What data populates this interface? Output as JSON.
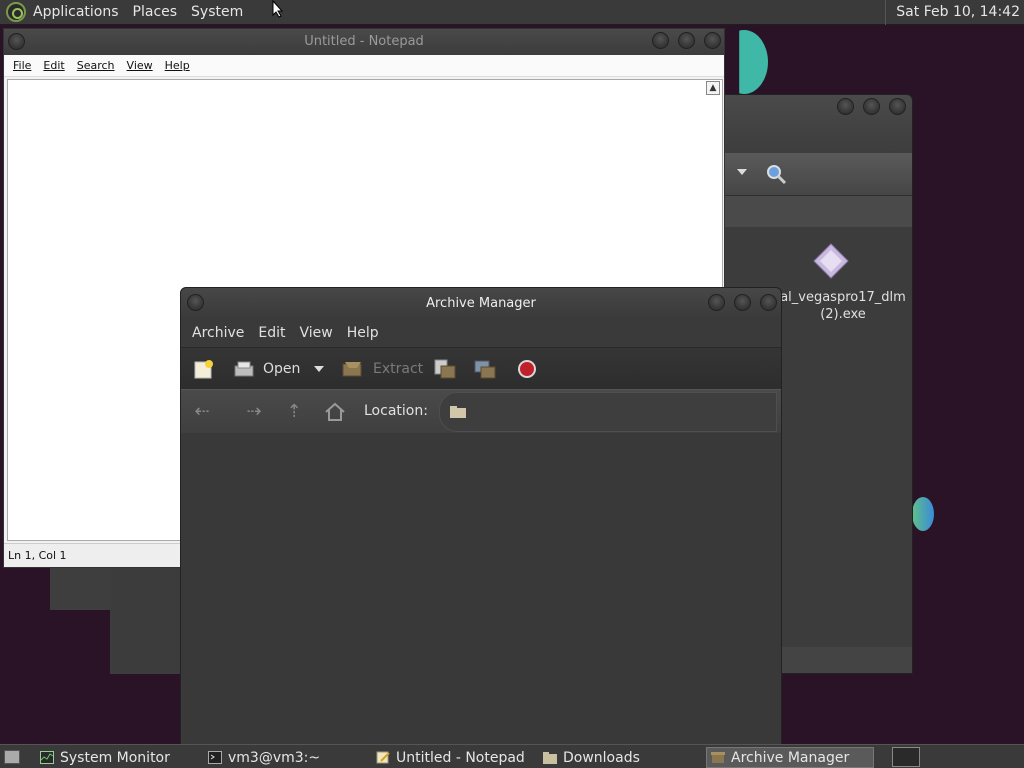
{
  "top_panel": {
    "menus": [
      "Applications",
      "Places",
      "System"
    ],
    "clock": "Sat Feb 10, 14:42"
  },
  "file_manager": {
    "file_label_line1": "al_vegaspro17_dlm",
    "file_label_line2": "(2).exe"
  },
  "notepad": {
    "title": "Untitled - Notepad",
    "menu": [
      "File",
      "Edit",
      "Search",
      "View",
      "Help"
    ],
    "status": "Ln 1, Col 1"
  },
  "archive_manager": {
    "title": "Archive Manager",
    "menu": [
      "Archive",
      "Edit",
      "View",
      "Help"
    ],
    "toolbar": {
      "open_label": "Open",
      "extract_label": "Extract"
    },
    "location_label": "Location:"
  },
  "taskbar": {
    "items": [
      {
        "label": "System Monitor",
        "icon": "system-monitor-icon"
      },
      {
        "label": "vm3@vm3:~",
        "icon": "terminal-icon"
      },
      {
        "label": "Untitled - Notepad",
        "icon": "notepad-icon"
      },
      {
        "label": "Downloads",
        "icon": "folder-icon"
      },
      {
        "label": "Archive Manager",
        "icon": "archive-manager-icon"
      }
    ],
    "active_index": 4
  },
  "colors": {
    "panel": "#3a3a3a",
    "desktop": "#2a1326",
    "window_dark": "#383838"
  }
}
